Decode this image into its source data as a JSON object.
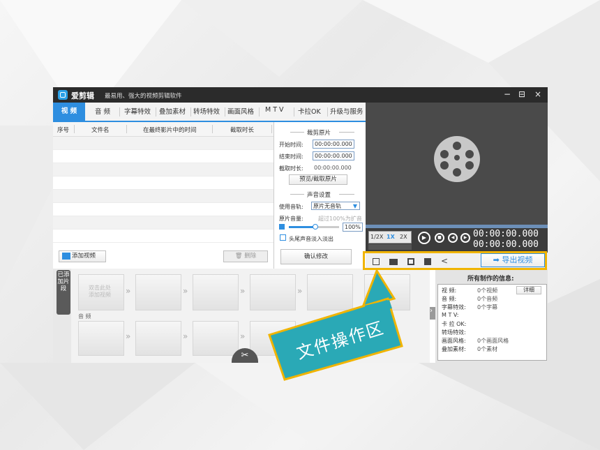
{
  "app": {
    "title": "爱剪辑",
    "subtitle": "最易用、强大的视频剪辑软件",
    "window_buttons": [
      "−",
      "⊟",
      "×"
    ]
  },
  "tabs": [
    "视 频",
    "音 频",
    "字幕特效",
    "叠加素材",
    "转场特效",
    "画面风格",
    "M T V",
    "卡拉OK",
    "升级与服务"
  ],
  "list": {
    "headers": [
      "序号",
      "文件名",
      "在最终影片中的时间",
      "截取时长"
    ],
    "add_video": "添加视频",
    "delete": "删除"
  },
  "clip_panel": {
    "cut_title": "裁剪原片",
    "start_label": "开始时间:",
    "start_value": "00:00:00.000",
    "end_label": "结束时间:",
    "end_value": "00:00:00.000",
    "dur_label": "截取时长:",
    "dur_value": "00:00:00.000",
    "preview_btn": "预览/截取原片",
    "sound_title": "声音设置",
    "track_label": "使用音轨:",
    "track_value": "原片无音轨",
    "vol_label": "原片音量:",
    "vol_hint": "超过100%为扩音",
    "vol_value": "100%",
    "fade_label": "头尾声音淡入淡出",
    "confirm": "确认修改"
  },
  "player": {
    "speeds": [
      "1/2X",
      "1X",
      "2X"
    ],
    "time1": "00:00:00.000",
    "time2": "00:00:00.000",
    "export": "导出视频"
  },
  "timeline": {
    "side_label": "已添加片段",
    "first_clip": "双击此处 添加视频",
    "audio_label": "音 频"
  },
  "info": {
    "title": "所有制作的信息:",
    "detail_btn": "详细",
    "rows": [
      {
        "k": "视 频:",
        "v": "0个视频"
      },
      {
        "k": "音 频:",
        "v": "0个音频"
      },
      {
        "k": "字幕特效:",
        "v": "0个字幕"
      },
      {
        "k": "M T V:",
        "v": ""
      },
      {
        "k": "卡 拉 OK:",
        "v": ""
      },
      {
        "k": "转场特效:",
        "v": ""
      },
      {
        "k": "画面风格:",
        "v": "0个画面风格"
      },
      {
        "k": "叠加素材:",
        "v": "0个素材"
      }
    ]
  },
  "callout": {
    "text": "文件操作区"
  },
  "colors": {
    "accent": "#2e8ee0",
    "highlight": "#f0b400",
    "callout": "#2aa9b6",
    "titlebar": "#2b2b2b"
  },
  "icons": [
    "new-file-icon",
    "open-folder-icon",
    "save-icon",
    "save-as-icon",
    "share-icon",
    "scissors-icon",
    "play-icon",
    "stop-icon",
    "prev-frame-icon",
    "next-frame-icon",
    "volume-icon",
    "film-reel-icon",
    "export-icon",
    "delete-icon"
  ]
}
